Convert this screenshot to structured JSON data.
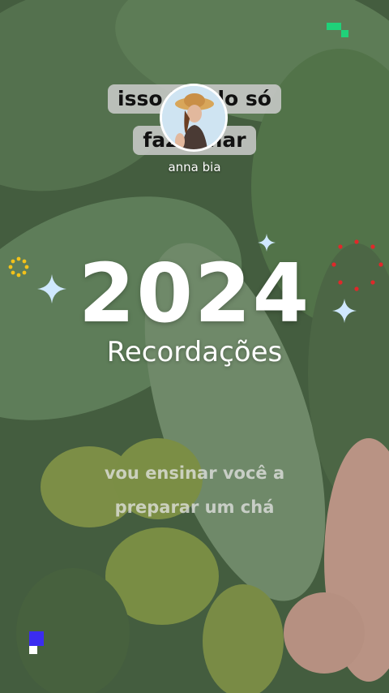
{
  "overlay": {
    "caption_top_line1": "isso tra  do só",
    "caption_top_line2": "fazer  nar",
    "username": "anna bia",
    "year": "2024",
    "subtitle": "Recordações",
    "caption_mid_line1": "vou ensinar você a",
    "caption_mid_line2": "preparar um chá"
  },
  "colors": {
    "background": "#4f6b4a",
    "caption_box": "#cdcdcd",
    "sparkle": "#cfe8ff",
    "dots_red": "#e0282a",
    "dots_yellow": "#f3c21a",
    "corner_green": "#1fd179",
    "corner_blue": "#3b2cf0"
  },
  "icons": [
    "sparkle-icon",
    "sun-dots-icon",
    "red-dot-ring-icon",
    "pixel-corner-icon"
  ]
}
